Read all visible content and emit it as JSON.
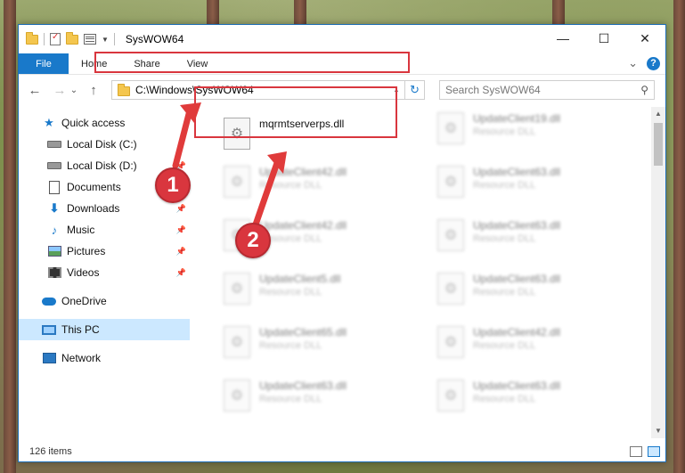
{
  "window": {
    "title": "SysWOW64",
    "controls": {
      "minimize": "—",
      "maximize": "☐",
      "close": "✕"
    }
  },
  "ribbon": {
    "tabs": [
      "File",
      "Home",
      "Share",
      "View"
    ],
    "expand": "⌄",
    "help": "?"
  },
  "address": {
    "path": "C:\\Windows\\SysWOW64",
    "refresh": "↻",
    "dropdown": "⌄"
  },
  "search": {
    "placeholder": "Search SysWOW64",
    "icon": "🔍"
  },
  "nav_buttons": {
    "back": "←",
    "forward": "→",
    "recent": "⌄",
    "up": "↑"
  },
  "sidebar": {
    "items": [
      {
        "label": "Quick access",
        "icon": "star-icon"
      },
      {
        "label": "Local Disk (C:)",
        "icon": "drive-icon"
      },
      {
        "label": "Local Disk (D:)",
        "icon": "drive-icon"
      },
      {
        "label": "Documents",
        "icon": "document-icon"
      },
      {
        "label": "Downloads",
        "icon": "download-icon"
      },
      {
        "label": "Music",
        "icon": "music-icon"
      },
      {
        "label": "Pictures",
        "icon": "pictures-icon"
      },
      {
        "label": "Videos",
        "icon": "videos-icon"
      },
      {
        "label": "OneDrive",
        "icon": "cloud-icon"
      },
      {
        "label": "This PC",
        "icon": "computer-icon"
      },
      {
        "label": "Network",
        "icon": "network-icon"
      }
    ],
    "pin": "📌"
  },
  "files": {
    "highlighted": {
      "name": "mqrmtserverps.dll"
    },
    "col1": [
      {
        "name": "UpdateClient42.dll",
        "type": "Resource DLL"
      },
      {
        "name": "UpdateClient42.dll",
        "type": "Resource DLL"
      },
      {
        "name": "UpdateClient5.dll",
        "type": "Resource DLL"
      },
      {
        "name": "UpdateClient65.dll",
        "type": "Resource DLL"
      },
      {
        "name": "UpdateClient63.dll",
        "type": "Resource DLL"
      }
    ],
    "col2": [
      {
        "name": "UpdateClient19.dll",
        "type": "Resource DLL"
      },
      {
        "name": "UpdateClient63.dll",
        "type": "Resource DLL"
      },
      {
        "name": "UpdateClient63.dll",
        "type": "Resource DLL"
      },
      {
        "name": "UpdateClient63.dll",
        "type": "Resource DLL"
      },
      {
        "name": "UpdateClient42.dll",
        "type": "Resource DLL"
      },
      {
        "name": "UpdateClient63.dll",
        "type": "Resource DLL"
      }
    ]
  },
  "status": {
    "count": "126 items"
  },
  "annotations": {
    "step1": "1",
    "step2": "2"
  },
  "colors": {
    "accent": "#1979ca",
    "highlight": "#d9363e"
  }
}
